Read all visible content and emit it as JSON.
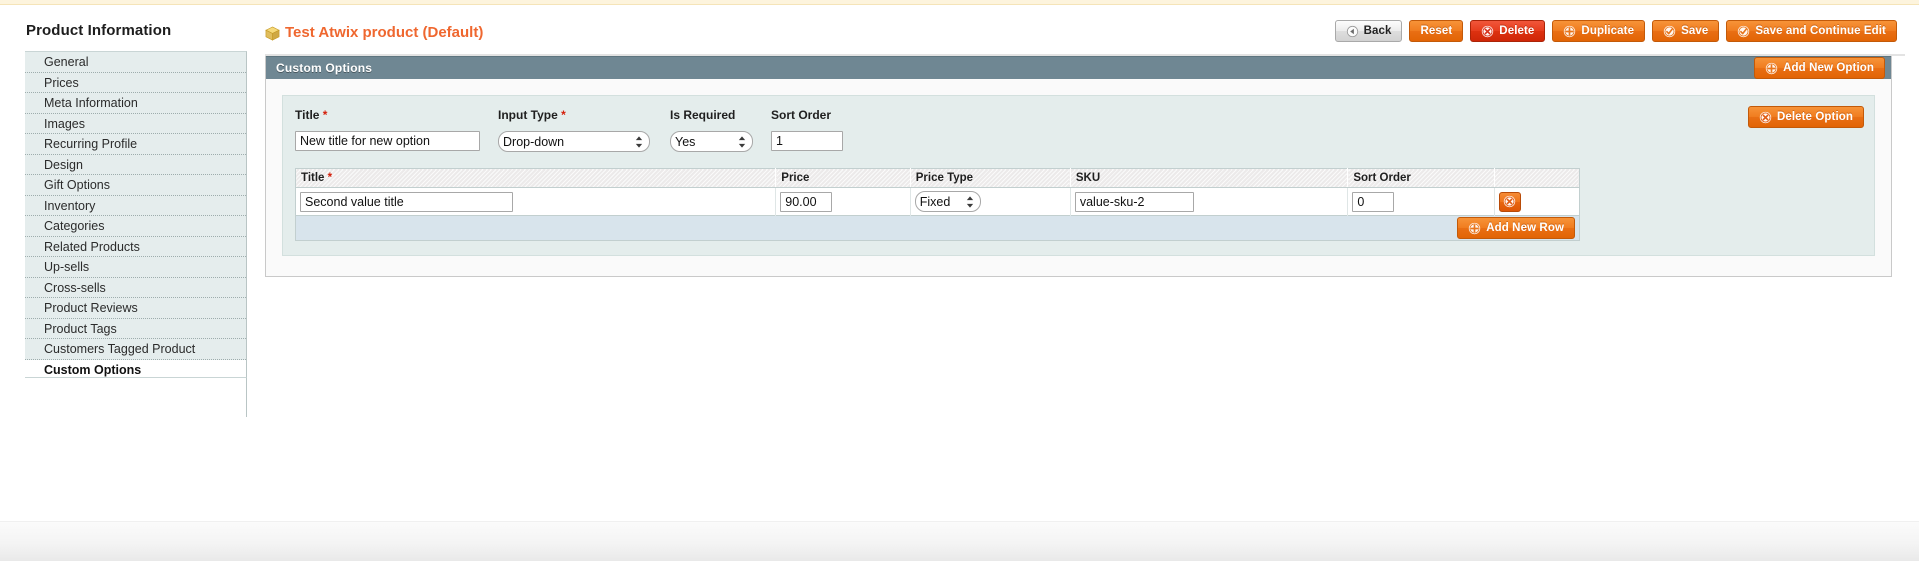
{
  "sidebar": {
    "title": "Product Information",
    "items": [
      {
        "label": "General",
        "active": false
      },
      {
        "label": "Prices",
        "active": false
      },
      {
        "label": "Meta Information",
        "active": false
      },
      {
        "label": "Images",
        "active": false
      },
      {
        "label": "Recurring Profile",
        "active": false
      },
      {
        "label": "Design",
        "active": false
      },
      {
        "label": "Gift Options",
        "active": false
      },
      {
        "label": "Inventory",
        "active": false
      },
      {
        "label": "Categories",
        "active": false
      },
      {
        "label": "Related Products",
        "active": false
      },
      {
        "label": "Up-sells",
        "active": false
      },
      {
        "label": "Cross-sells",
        "active": false
      },
      {
        "label": "Product Reviews",
        "active": false
      },
      {
        "label": "Product Tags",
        "active": false
      },
      {
        "label": "Customers Tagged Product",
        "active": false
      },
      {
        "label": "Custom Options",
        "active": true
      }
    ]
  },
  "header": {
    "title": "Test Atwix product (Default)",
    "title_color": "#ef672f",
    "buttons": [
      {
        "label": "Back",
        "style": "gray",
        "icon": "back-arrow-icon"
      },
      {
        "label": "Reset",
        "style": "orange",
        "icon": "none"
      },
      {
        "label": "Delete",
        "style": "red",
        "icon": "delete-circle-icon"
      },
      {
        "label": "Duplicate",
        "style": "orange",
        "icon": "plus-circle-icon"
      },
      {
        "label": "Save",
        "style": "orange",
        "icon": "check-circle-icon"
      },
      {
        "label": "Save and Continue Edit",
        "style": "orange",
        "icon": "check-circle-icon"
      }
    ]
  },
  "panel": {
    "title": "Custom Options",
    "header_bg": "#6f8793",
    "add_new_option_label": "Add New Option",
    "delete_option_label": "Delete Option"
  },
  "option": {
    "fields": [
      {
        "label": "Title",
        "required": true,
        "type": "text",
        "value": "New title for new option"
      },
      {
        "label": "Input Type",
        "required": true,
        "type": "select",
        "value": "Drop-down"
      },
      {
        "label": "Is Required",
        "required": false,
        "type": "select",
        "value": "Yes"
      },
      {
        "label": "Sort Order",
        "required": false,
        "type": "text",
        "value": "1"
      }
    ]
  },
  "values_table": {
    "columns": [
      {
        "label": "Title",
        "required": true
      },
      {
        "label": "Price",
        "required": false
      },
      {
        "label": "Price Type",
        "required": false
      },
      {
        "label": "SKU",
        "required": false
      },
      {
        "label": "Sort Order",
        "required": false
      },
      {
        "label": "",
        "required": false
      }
    ],
    "rows": [
      {
        "title": "Second value title",
        "price": "90.00",
        "price_type": "Fixed",
        "sku": "value-sku-2",
        "sort_order": "0"
      }
    ],
    "add_new_row_label": "Add New Row"
  }
}
